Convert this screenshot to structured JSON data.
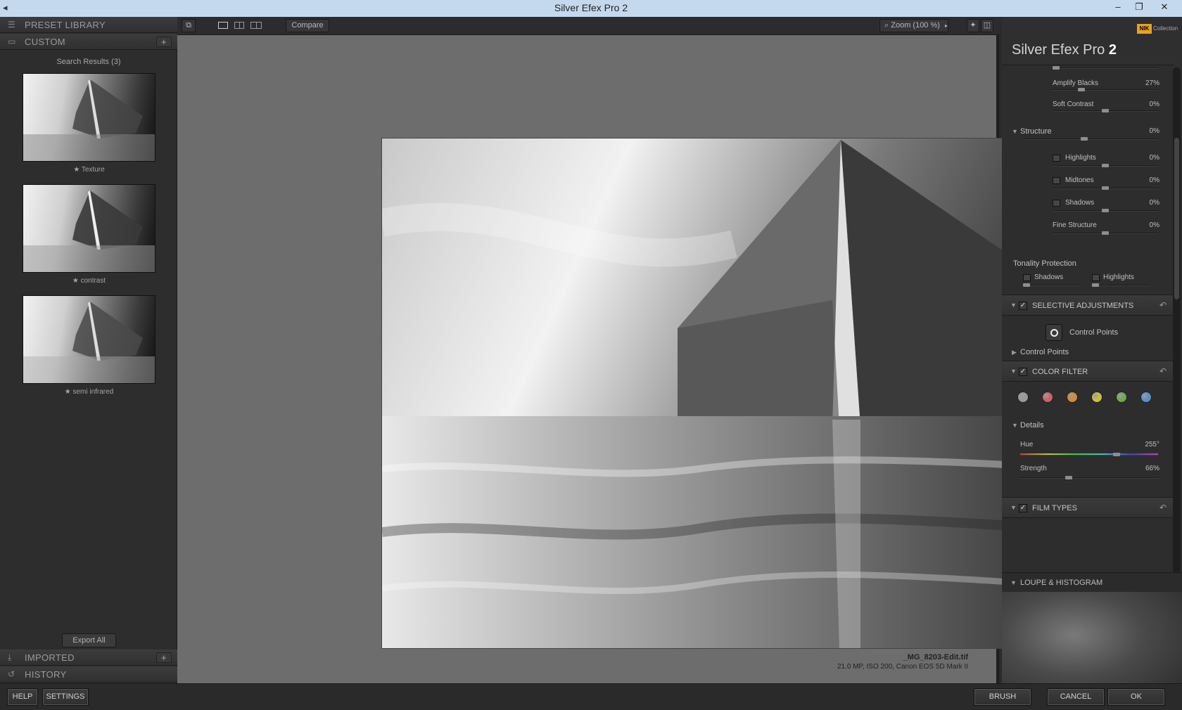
{
  "window": {
    "title": "Silver Efex Pro 2",
    "controls": [
      "–",
      "❐",
      "✕"
    ]
  },
  "left_panel": {
    "preset_library": "PRESET LIBRARY",
    "custom": "CUSTOM",
    "search_results": "Search Results (3)",
    "presets": [
      {
        "name": "★ Texture"
      },
      {
        "name": "★ contrast"
      },
      {
        "name": "★ semi infrared"
      }
    ],
    "export_all": "Export All",
    "imported": "IMPORTED",
    "history": "HISTORY",
    "plus": "+"
  },
  "toolbar": {
    "compare": "Compare",
    "zoom": "Zoom (100 %)"
  },
  "canvas": {
    "filename": "_MG_8203-Edit.tif",
    "meta": "21.0 MP, ISO 200, Canon EOS 5D Mark II"
  },
  "right_panel": {
    "title_main": "Silver Efex Pro",
    "title_num": "2",
    "badge": "Collection",
    "badge_logo": "NIK",
    "sliders": [
      {
        "label": "Amplify Blacks",
        "value": "27%",
        "level": 0.27
      },
      {
        "label": "Soft Contrast",
        "value": "0%",
        "level": 0.5
      }
    ],
    "structure": {
      "label": "Structure",
      "value": "0%",
      "level": 0.4
    },
    "structure_items": [
      {
        "label": "Highlights",
        "value": "0%"
      },
      {
        "label": "Midtones",
        "value": "0%"
      },
      {
        "label": "Shadows",
        "value": "0%"
      }
    ],
    "fine_structure": {
      "label": "Fine Structure",
      "value": "0%"
    },
    "tonality_protection": "Tonality Protection",
    "tonality_shadows": "Shadows",
    "tonality_highlights": "Highlights",
    "selective_adjustments": "SELECTIVE ADJUSTMENTS",
    "control_points_button": "Control Points",
    "control_points_sub": "Control Points",
    "color_filter": "COLOR FILTER",
    "filter_colors": [
      "#9a9a9a",
      "#d06060",
      "#d08a3a",
      "#c8c040",
      "#6aaa50",
      "#5a90cc"
    ],
    "details": "Details",
    "hue": {
      "label": "Hue",
      "value": "255°",
      "level": 0.7
    },
    "strength": {
      "label": "Strength",
      "value": "66%",
      "level": 0.33
    },
    "film_types": "FILM TYPES",
    "loupe_histogram": "LOUPE & HISTOGRAM"
  },
  "bottom": {
    "help": "HELP",
    "settings": "SETTINGS",
    "brush": "BRUSH",
    "cancel": "CANCEL",
    "ok": "OK"
  }
}
